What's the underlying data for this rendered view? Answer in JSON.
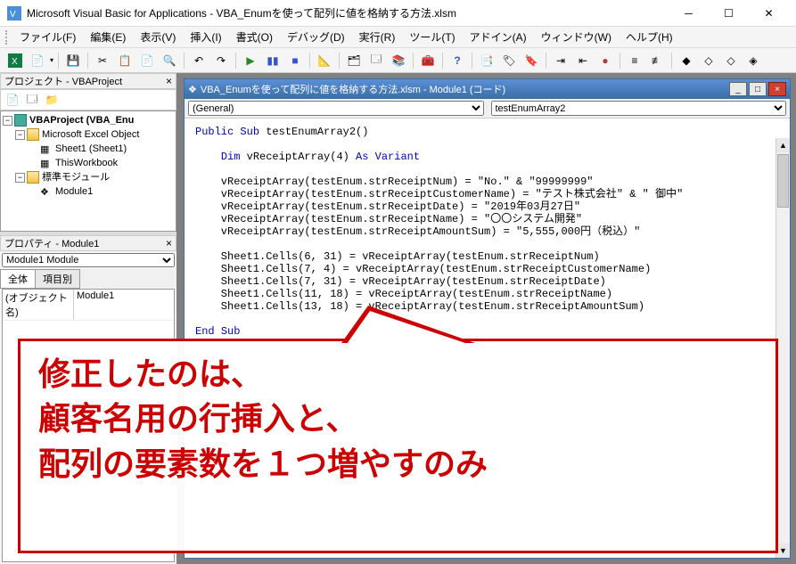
{
  "window": {
    "title": "Microsoft Visual Basic for Applications - VBA_Enumを使って配列に値を格納する方法.xlsm"
  },
  "menu": {
    "file": "ファイル(F)",
    "edit": "編集(E)",
    "view": "表示(V)",
    "insert": "挿入(I)",
    "format": "書式(O)",
    "debug": "デバッグ(D)",
    "run": "実行(R)",
    "tools": "ツール(T)",
    "addins": "アドイン(A)",
    "window": "ウィンドウ(W)",
    "help": "ヘルプ(H)"
  },
  "project_panel": {
    "title": "プロジェクト - VBAProject",
    "root": "VBAProject (VBA_Enu",
    "excel_objects": "Microsoft Excel Object",
    "sheet1": "Sheet1 (Sheet1)",
    "thisworkbook": "ThisWorkbook",
    "std_modules": "標準モジュール",
    "module1": "Module1"
  },
  "props_panel": {
    "title": "プロパティ - Module1",
    "object_combo": "Module1 Module",
    "tab_all": "全体",
    "tab_categorized": "項目別",
    "prop_name_label": "(オブジェクト名)",
    "prop_name_value": "Module1"
  },
  "code_window": {
    "title": "VBA_Enumを使って配列に値を格納する方法.xlsm - Module1 (コード)",
    "dropdown_left": "(General)",
    "dropdown_right": "testEnumArray2",
    "code_lines": [
      "Public Sub testEnumArray2()",
      "",
      "    Dim vReceiptArray(4) As Variant",
      "",
      "    vReceiptArray(testEnum.strReceiptNum) = \"No.\" & \"99999999\"",
      "    vReceiptArray(testEnum.strReceiptCustomerName) = \"テスト株式会社\" & \" 御中\"",
      "    vReceiptArray(testEnum.strReceiptDate) = \"2019年03月27日\"",
      "    vReceiptArray(testEnum.strReceiptName) = \"〇〇システム開発\"",
      "    vReceiptArray(testEnum.strReceiptAmountSum) = \"5,555,000円（税込）\"",
      "",
      "    Sheet1.Cells(6, 31) = vReceiptArray(testEnum.strReceiptNum)",
      "    Sheet1.Cells(7, 4) = vReceiptArray(testEnum.strReceiptCustomerName)",
      "    Sheet1.Cells(7, 31) = vReceiptArray(testEnum.strReceiptDate)",
      "    Sheet1.Cells(11, 18) = vReceiptArray(testEnum.strReceiptName)",
      "    Sheet1.Cells(13, 18) = vReceiptArray(testEnum.strReceiptAmountSum)",
      "",
      "End Sub"
    ]
  },
  "annotation": {
    "line1": "修正したのは、",
    "line2": "顧客名用の行挿入と、",
    "line3": "配列の要素数を１つ増やすのみ"
  }
}
